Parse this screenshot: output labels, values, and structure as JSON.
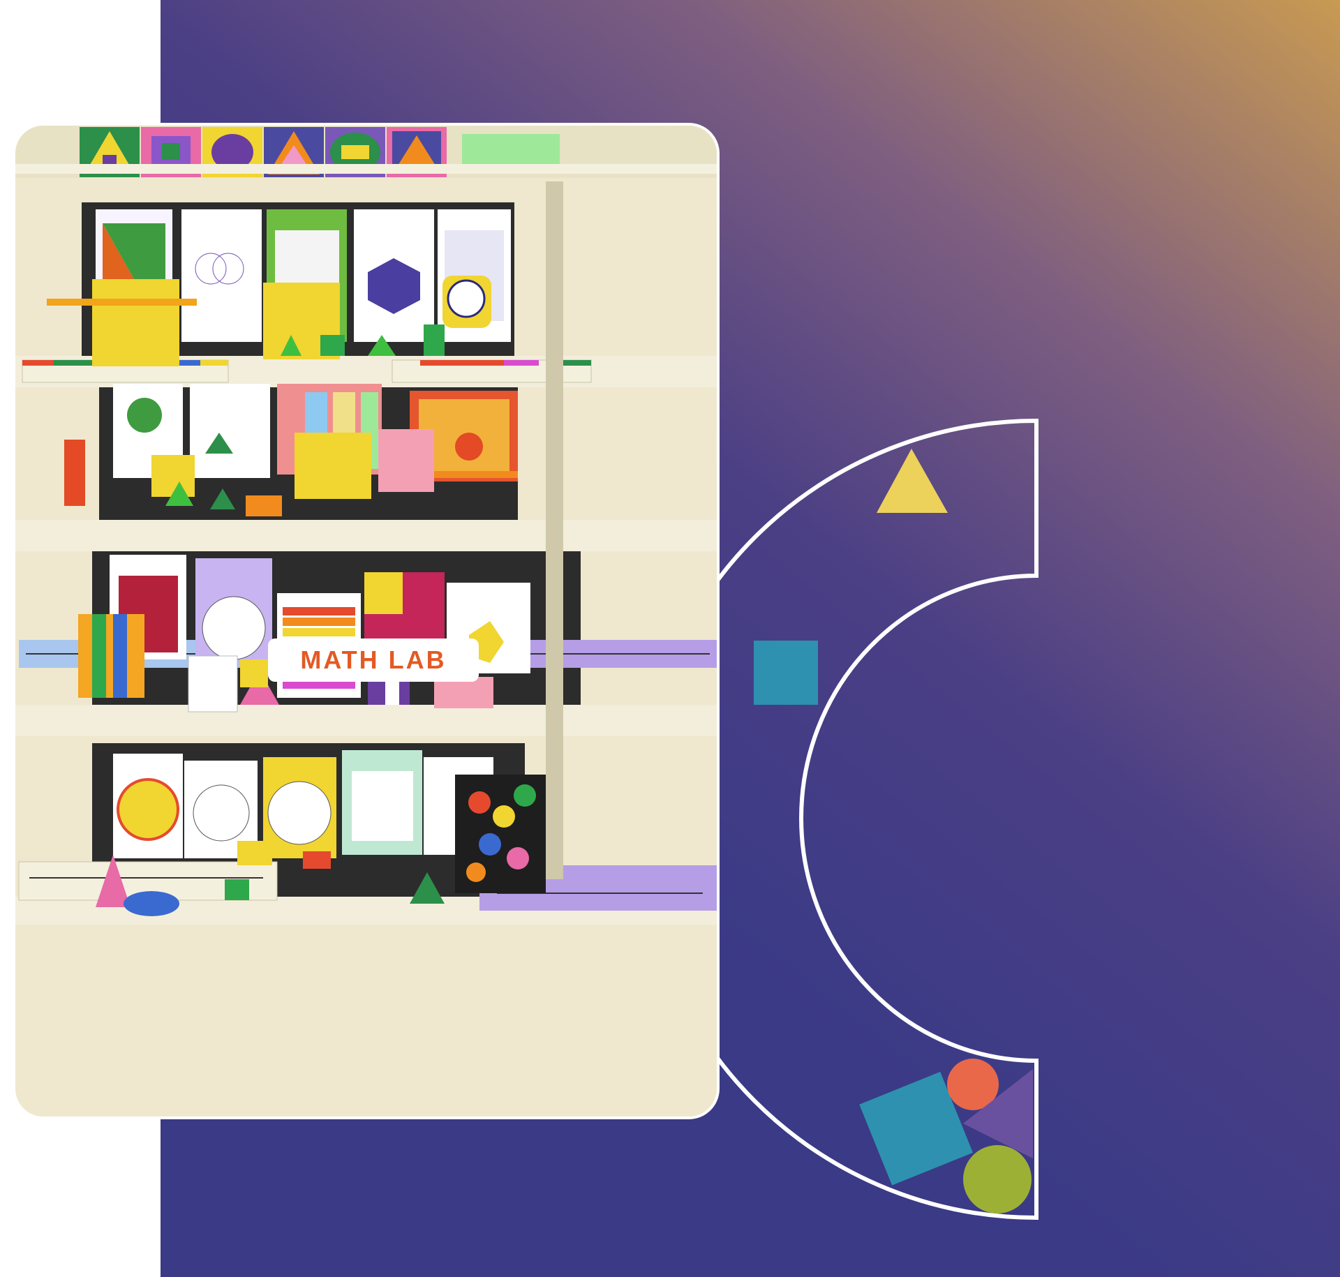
{
  "photo": {
    "sign_label": "MATH LAB"
  },
  "colors": {
    "panel_top_right": "#c89a52",
    "panel_mid": "#6b4f86",
    "panel_bottom": "#3a3a86",
    "arc_stroke": "#ffffff",
    "triangle_yellow": "#ecd15b",
    "square_teal": "#2e91b0",
    "circle_orange": "#e9684a",
    "triangle_purple": "#6a51a0",
    "circle_green": "#9db036",
    "shelf_cream": "#efe8cf",
    "shelf_back": "#2c2c2c"
  },
  "icons": [
    "yellow-triangle-icon",
    "teal-square-icon",
    "orange-circle-icon",
    "purple-triangle-icon",
    "green-circle-icon"
  ]
}
